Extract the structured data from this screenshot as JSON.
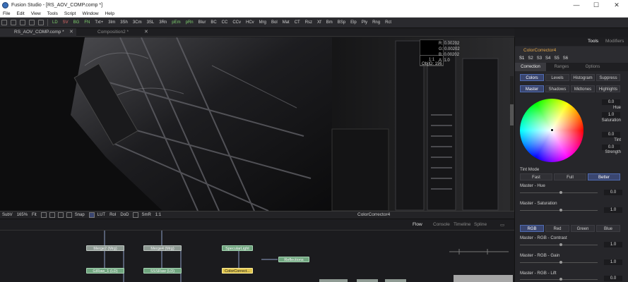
{
  "window": {
    "title": "Fusion Studio - [RS_AOV_COMP.comp *]",
    "minimize": "—",
    "maximize": "☐",
    "close": "✕"
  },
  "menu": [
    "File",
    "Edit",
    "View",
    "Tools",
    "Script",
    "Window",
    "Help"
  ],
  "toolbar": [
    "LD",
    "SV",
    "BG",
    "FN",
    "Txt+",
    "3Im",
    "3Sh",
    "3Cm",
    "3SL",
    "3Rn",
    "pEm",
    "pRn",
    "Blur",
    "BC",
    "CC",
    "CCv",
    "HCv",
    "Mrg",
    "Bol",
    "Mat",
    "CT",
    "Rsz",
    "Xf",
    "Bm",
    "BSp",
    "Elp",
    "Ply",
    "Rng",
    "Rct"
  ],
  "tabs": [
    {
      "label": "RS_AOV_COMP.comp *",
      "close": "✕"
    },
    {
      "label": "Composition2 *",
      "close": "✕"
    }
  ],
  "pixel_info": {
    "r": "R: 0.00202",
    "g": "G: 0.00202",
    "b": "B: 0.00202",
    "a": "A: 1.0",
    "objid": "ObjID: 196",
    "ratio": "1:1"
  },
  "viewer_bar": {
    "view": "SubV",
    "zoom": "165%",
    "fit": "Fit",
    "snap": "Snap",
    "lut": "LUT",
    "roi": "RoI",
    "dod": "DoD",
    "smr": "SmR",
    "ratio": "1:1",
    "node": "ColorCorrector4"
  },
  "flow_tabs": {
    "flow": "Flow",
    "console": "Console",
    "timeline": "Timeline",
    "spline": "Spline"
  },
  "nodes": {
    "merge2": "Merge2 (Mrg)",
    "merge4": "Merge4 (Mrg)",
    "specular": "SpecularLight",
    "reflections": "Reflections",
    "graw": "GIRaw_1 (LD)",
    "sssraw": "SSSRaw (LD)",
    "colorcorrect": "ColorCorrect..."
  },
  "panel": {
    "tools_tab": "Tools",
    "modifiers_tab": "Modifiers",
    "node_name": "ColorCorrector4",
    "slots": [
      "S1",
      "S2",
      "S3",
      "S4",
      "S5",
      "S6"
    ],
    "tabs": [
      "Correction",
      "Ranges",
      "Options"
    ],
    "modes": [
      "Colors",
      "Levels",
      "Histogram",
      "Suppress"
    ],
    "ranges": [
      "Master",
      "Shadows",
      "Midtones",
      "Highlights"
    ],
    "wheel": {
      "v1": "0.0",
      "hue_label": "Hue",
      "hue": "1.0",
      "sat_label": "Saturation",
      "v3": "0.0",
      "tint_label": "Tint",
      "tint": "0.0",
      "strength_label": "Strength"
    },
    "tint_mode_label": "Tint Mode",
    "tint_modes": [
      "Fast",
      "Full",
      "Better"
    ],
    "sliders": [
      {
        "label": "Master - Hue",
        "value": "0.0"
      },
      {
        "label": "Master - Saturation",
        "value": "1.0"
      }
    ],
    "channels": [
      "RGB",
      "Red",
      "Green",
      "Blue"
    ],
    "sliders2": [
      {
        "label": "Master - RGB - Contrast",
        "value": "1.0"
      },
      {
        "label": "Master - RGB - Gain",
        "value": "1.0"
      },
      {
        "label": "Master - RGB - Lift",
        "value": "0.0"
      }
    ]
  }
}
